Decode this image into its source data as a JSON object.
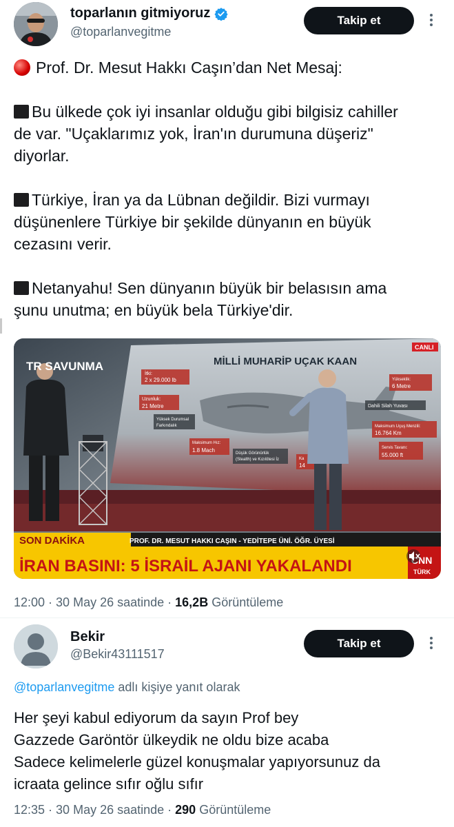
{
  "tweet1": {
    "display_name": "toparlanın gitmiyoruz",
    "handle": "@toparlanvegitme",
    "follow_label": "Takip et",
    "text": {
      "header": "Prof. Dr. Mesut Hakkı Caşın’dan Net Mesaj:",
      "p1_line1": "Bu ülkede çok iyi insanlar olduğu gibi bilgisiz cahiller",
      "p1_line2": "de var. \"Uçaklarımız yok, İran'ın durumuna düşeriz\"",
      "p1_line3": "diyorlar.",
      "p2_line1": "Türkiye, İran ya da Lübnan değildir. Bizi vurmayı",
      "p2_line2": "düşünenlere Türkiye bir şekilde dünyanın en büyük",
      "p2_line3": "cezasını verir.",
      "p3_line1": "Netanyahu! Sen dünyanın büyük bir belasısın ama",
      "p3_line2": "şunu unutma; en büyük bela Türkiye'dir."
    },
    "media": {
      "channel_logo": "TR SAVUNMA",
      "live_badge": "CANLI",
      "screen_title": "MİLLİ MUHARİP UÇAK KAAN",
      "labels": {
        "itki": "İtki:",
        "itki_value": "2 x 29.000 lb",
        "uzunluk": "Uzunluk:",
        "uzunluk_value": "21 Metre",
        "yuksek_durumsal": "Yüksek Durumsal",
        "farkindalik": "Farkındalık",
        "maks_hiz": "Maksimum Hız:",
        "maks_hiz_value": "1.8 Mach",
        "dusuk_gorunurluk": "Düşük Görünürlük",
        "stealth": "(Stealth) ve Kızılötesi İz",
        "kanat": "Ka",
        "kanat_value": "14",
        "yukseklik": "Yükseklik:",
        "yukseklik_value": "6 Metre",
        "dahili": "Dahili Silah Yuvası",
        "menzil": "Maksimum Uçuş Menzili:",
        "menzil_value": "16.764 Km",
        "servis": "Servis Tavanı:",
        "servis_value": "55.000 ft"
      },
      "son_dakika": "SON DAKİKA",
      "guest_caption": "PROF. DR. MESUT HAKKI CAŞIN - YEDİTEPE ÜNİ. ÖĞR. ÜYESİ",
      "headline": "İRAN BASINI: 5 İSRAİL AJANI YAKALANDI",
      "brand": "CNN",
      "brand_sub": "TÜRK"
    },
    "time": "12:00",
    "date": "30 May 26 saatinde",
    "views_count": "16,2B",
    "views_label": "Görüntüleme"
  },
  "tweet2": {
    "display_name": "Bekir",
    "handle": "@Bekir43111517",
    "follow_label": "Takip et",
    "reply_handle": "@toparlanvegitme",
    "reply_suffix": "adlı kişiye yanıt olarak",
    "text_line1": "Her şeyi kabul ediyorum da sayın Prof bey",
    "text_line2": "Gazzede  Garöntör ülkeydik ne oldu bize acaba",
    "text_line3": "Sadece kelimelerle güzel konuşmalar yapıyorsunuz da",
    "text_line4": "icraata gelince sıfır oğlu sıfır",
    "time": "12:35",
    "date": "30 May 26 saatinde",
    "views_count": "290",
    "views_label": "Görüntüleme"
  },
  "colors": {
    "text": "#0f1419",
    "secondary": "#536471",
    "link": "#1d9bf0",
    "button": "#0f1419",
    "verified": "#1d9bf0",
    "headline_bar": "#f7c600",
    "son_dakika": "#f7c600"
  },
  "icons": [
    "verified-badge-icon",
    "more-options-icon",
    "red-circle-icon",
    "black-square-icon",
    "mute-icon",
    "default-avatar-icon"
  ]
}
